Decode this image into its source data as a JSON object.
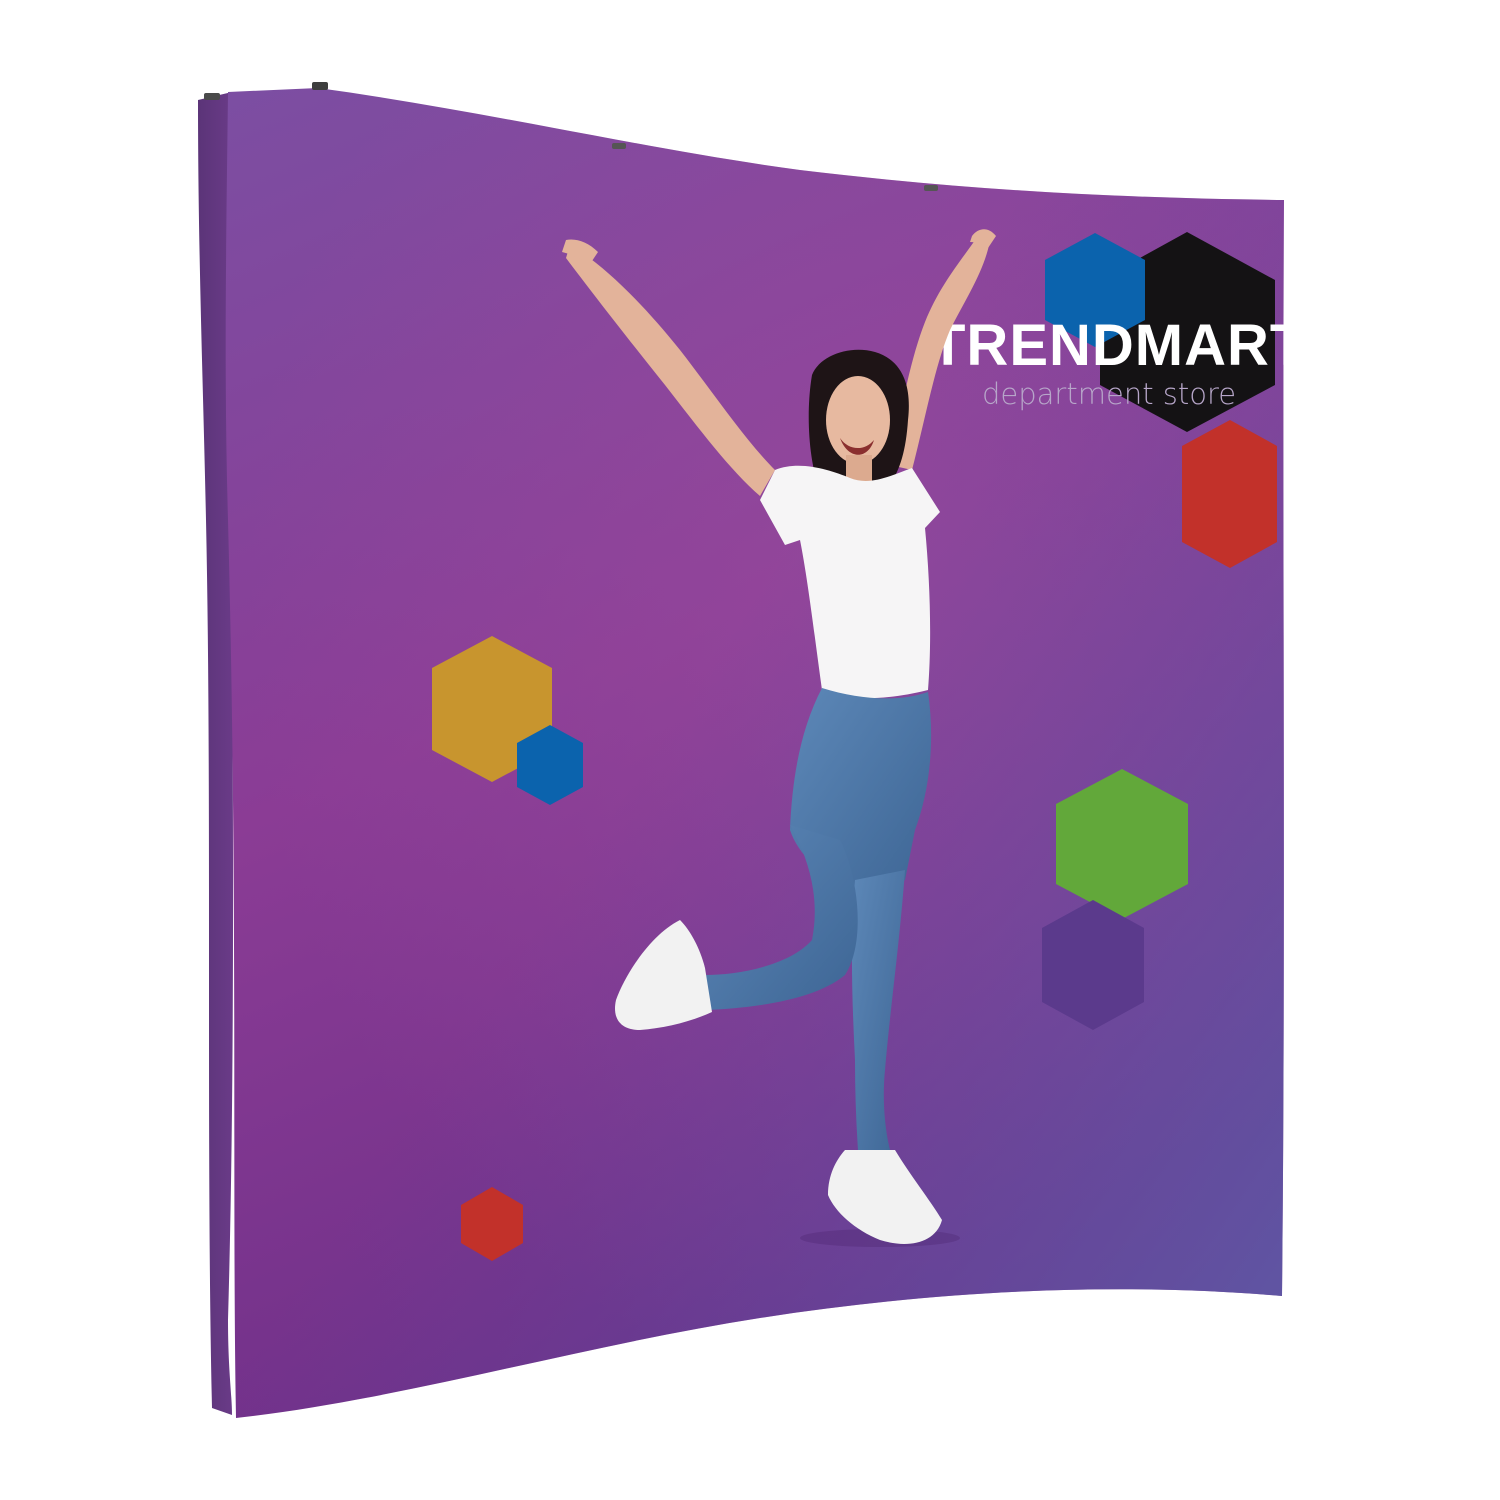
{
  "scene": {
    "subject": "pop-up display"
  },
  "logo": {
    "name": "TRENDMART",
    "tagline": "department store"
  },
  "colors": {
    "background": "#ffffff",
    "panel_top": "#7a4fa0",
    "panel_mid": "#8a3a95",
    "panel_bottom": "#6a2f86",
    "side_edge": "#5e3379",
    "hex_blue": "#0b63ad",
    "hex_black": "#141214",
    "hex_red": "#c2312a",
    "hex_gold": "#c8952e",
    "hex_green": "#62a83a",
    "hex_purple": "#5b3a8c",
    "shirt": "#f6f5f6",
    "jeans": "#4b76a6",
    "hair": "#1e1416",
    "skin": "#e3b39a",
    "shoe": "#f2f2f2"
  }
}
